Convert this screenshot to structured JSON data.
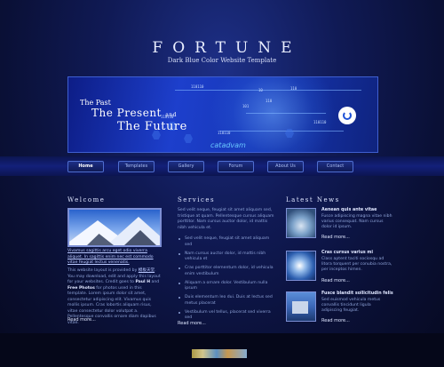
{
  "site": {
    "title": "FORTUNE",
    "tagline": "Dark Blue Color Website Template"
  },
  "banner": {
    "line1": "The Past",
    "line2": "The Present",
    "line2_suffix": "and",
    "line3": "The Future",
    "logo": "catadvam",
    "numbers": [
      "110110",
      "10",
      "110",
      "110110",
      "101",
      "110",
      "110110",
      "110110"
    ]
  },
  "nav": {
    "items": [
      "Home",
      "Templates",
      "Gallery",
      "Forum",
      "About Us",
      "Contact"
    ],
    "active": 0
  },
  "welcome": {
    "heading": "Welcome",
    "link_text": "Vivamus sagittis arcu eget odio viverra aliquet. In sagittis enim nec est commodo vitae feugiat lectus venenatis.",
    "body_start": "This website layout is provided by ",
    "body_brand": "模板天堂",
    "body_mid": ". You may download, edit and apply this layout for your websites. Credit goes to ",
    "body_bold1": "Paul H",
    "body_and": " and ",
    "body_bold2": "Free Photos",
    "body_end": " for photos used in this template. Lorem ipsum dolor sit amet, consectetur adipiscing elit. Vivamus quis mollis ipsum. Cras lobortis aliquam risus, vitae consectetur dolor volutpat a. Pellentesque convallis ornare diam dapibus vitae.",
    "read_more": "Read more..."
  },
  "services": {
    "heading": "Services",
    "intro": "Sed velit neque, feugiat sit amet aliquam sed, tristique at quam. Pellentesque cursus aliquam porttitor. Nam cursus auctor dolor, id mattis nibh vehicula et.",
    "items": [
      "Sed velit neque, feugiat sit amet aliquam sed",
      "Nam cursus auctor dolor, id mattis nibh vehicula et",
      "Cras porttitor elementum dolor, id vehicula enim vestibulum",
      "Aliquam a ornare dolor. Vestibulum nulla ipsum",
      "Duis elementum leo dui. Duis at lectus sed metus placerat",
      "Vestibulum vel tellus, placerat sed viverra sed"
    ],
    "read_more": "Read more..."
  },
  "news": {
    "heading": "Latest News",
    "items": [
      {
        "title": "Aenean quis ante vitae",
        "body": "Fusce adipiscing magna vitae nibh varius consequat. Nam cursus dolor id ipsum.",
        "read_more": "Read more..."
      },
      {
        "title": "Cras cursus varius mi",
        "body": "Class aptent taciti sociosqu ad litora torquent per conubia nostra, per inceptos himen.",
        "read_more": "Read more..."
      },
      {
        "title": "Fusce blandit sollicitudin felis",
        "body": "Sed euismod vehicula metus convallis tincidunt ligula adipiscing feugiat.",
        "read_more": "Read more..."
      }
    ]
  }
}
